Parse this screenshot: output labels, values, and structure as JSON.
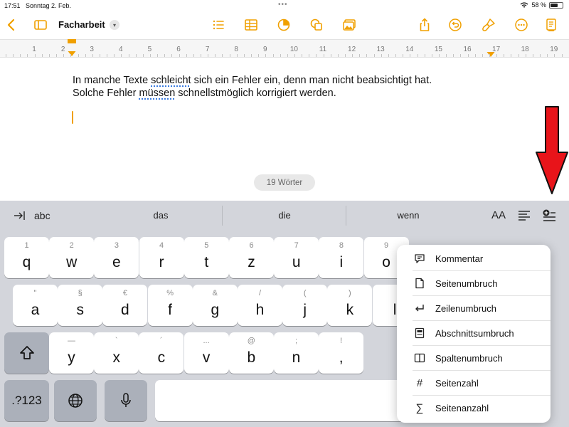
{
  "status_bar": {
    "time": "17:51",
    "date": "Sonntag 2. Feb.",
    "battery": "58 %",
    "battery_level": 0.58
  },
  "toolbar": {
    "title": "Facharbeit",
    "icons": [
      "back-chevron-icon",
      "sidebar-icon",
      "list-icon",
      "table-icon",
      "chart-icon",
      "shapes-icon",
      "media-icon",
      "share-icon",
      "undo-icon",
      "brush-icon",
      "more-icon",
      "document-icon"
    ]
  },
  "ruler": {
    "numbers": [
      "1",
      "2",
      "3",
      "4",
      "5",
      "6",
      "7",
      "8",
      "9",
      "10",
      "11",
      "12",
      "13",
      "14",
      "15",
      "16",
      "17",
      "18",
      "19"
    ]
  },
  "document": {
    "line1_a": "In manche Texte ",
    "line1_b": "schleicht",
    "line1_c": " sich ein Fehler ein, denn man nicht beabsichtigt hat.",
    "line2_a": "Solche Fehler ",
    "line2_b": "müssen",
    "line2_c": " schnellstmöglich korrigiert werden.",
    "word_count": "19 Wörter"
  },
  "suggestions": {
    "left_label": "abc",
    "words": [
      "das",
      "die",
      "wenn"
    ],
    "aa_label": "AA"
  },
  "keyboard": {
    "row1": [
      {
        "secondary": "1",
        "primary": "q"
      },
      {
        "secondary": "2",
        "primary": "w"
      },
      {
        "secondary": "3",
        "primary": "e"
      },
      {
        "secondary": "4",
        "primary": "r"
      },
      {
        "secondary": "5",
        "primary": "t"
      },
      {
        "secondary": "6",
        "primary": "z"
      },
      {
        "secondary": "7",
        "primary": "u"
      },
      {
        "secondary": "8",
        "primary": "i"
      },
      {
        "secondary": "9",
        "primary": "o"
      }
    ],
    "row2": [
      {
        "secondary": "\"",
        "primary": "a"
      },
      {
        "secondary": "§",
        "primary": "s"
      },
      {
        "secondary": "€",
        "primary": "d"
      },
      {
        "secondary": "%",
        "primary": "f"
      },
      {
        "secondary": "&",
        "primary": "g"
      },
      {
        "secondary": "/",
        "primary": "h"
      },
      {
        "secondary": "(",
        "primary": "j"
      },
      {
        "secondary": ")",
        "primary": "k"
      },
      {
        "secondary": "",
        "primary": "l"
      }
    ],
    "row3": [
      {
        "secondary": "—",
        "primary": "y"
      },
      {
        "secondary": "`",
        "primary": "x"
      },
      {
        "secondary": "´",
        "primary": "c"
      },
      {
        "secondary": "...",
        "primary": "v"
      },
      {
        "secondary": "@",
        "primary": "b"
      },
      {
        "secondary": ";",
        "primary": "n"
      },
      {
        "secondary": "!",
        "primary": ","
      }
    ],
    "numbers_key": ".?123"
  },
  "insert_menu": {
    "items": [
      {
        "label": "Kommentar",
        "icon": "comment-icon"
      },
      {
        "label": "Seitenumbruch",
        "icon": "page-icon"
      },
      {
        "label": "Zeilenumbruch",
        "icon": "return-arrow-icon"
      },
      {
        "label": "Abschnittsumbruch",
        "icon": "section-icon"
      },
      {
        "label": "Spaltenumbruch",
        "icon": "columns-icon"
      },
      {
        "label": "Seitenzahl",
        "icon": "hash-icon",
        "glyph": "#"
      },
      {
        "label": "Seitenanzahl",
        "icon": "sigma-icon",
        "glyph": "∑"
      }
    ]
  },
  "colors": {
    "accent": "#F0A000",
    "annotation_arrow": "#E8141A",
    "keyboard_bg": "#D3D5DB"
  }
}
